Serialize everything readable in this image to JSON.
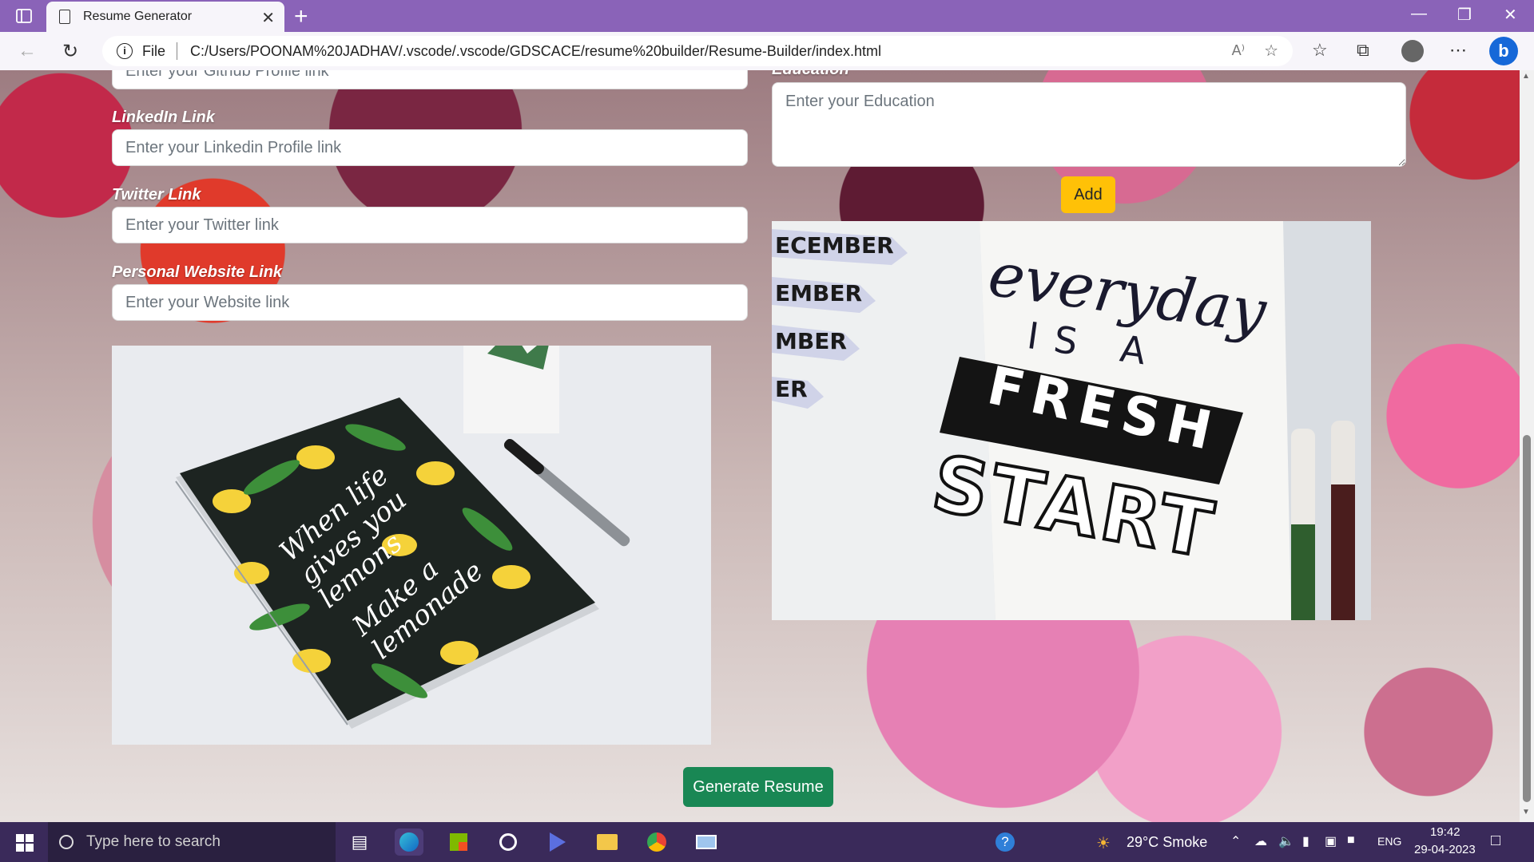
{
  "browser": {
    "tab_title": "Resume Generator",
    "tab_close_glyph": "✕",
    "new_tab_glyph": "+",
    "url_scheme_label": "File",
    "url": "C:/Users/POONAM%20JADHAV/.vscode/.vscode/GDSCACE/resume%20builder/Resume-Builder/index.html"
  },
  "form": {
    "github": {
      "placeholder": "Enter your Github Profile link"
    },
    "linkedin": {
      "label": "LinkedIn Link",
      "placeholder": "Enter your Linkedin Profile link"
    },
    "twitter": {
      "label": "Twitter Link",
      "placeholder": "Enter your Twitter link"
    },
    "website": {
      "label": "Personal Website Link",
      "placeholder": "Enter your Website link"
    },
    "education": {
      "label": "Education",
      "placeholder": "Enter your Education"
    },
    "add_label": "Add",
    "generate_label": "Generate Resume"
  },
  "images": {
    "notebook_text": [
      "When life",
      "gives you",
      "lemons",
      "Make a",
      "lemonade"
    ],
    "journal_text": {
      "line1": "everyday",
      "line2": "IS A",
      "line3": "FRESH",
      "line4": "START",
      "months": [
        "ECEMBER",
        "EMBER",
        "MBER",
        "ER"
      ]
    }
  },
  "taskbar": {
    "search_placeholder": "Type here to search",
    "weather": "29°C  Smoke",
    "language": "ENG",
    "time": "19:42",
    "date": "29-04-2023"
  },
  "colors": {
    "tabbar": "#8a63b8",
    "add_button": "#ffc107",
    "generate_button": "#198754",
    "taskbar": "#3a2a5a"
  },
  "icons": [
    "sidebar-toggle-icon",
    "document-icon",
    "back-icon",
    "refresh-icon",
    "info-icon",
    "read-aloud-icon",
    "add-favorite-icon",
    "favorites-icon",
    "collections-icon",
    "profile-icon",
    "more-icon",
    "bing-icon",
    "windows-start-icon",
    "search-icon",
    "task-view-icon",
    "edge-icon",
    "store-icon",
    "app-icon",
    "video-icon",
    "file-explorer-icon",
    "chrome-icon",
    "remote-desktop-icon",
    "help-icon",
    "weather-icon"
  ]
}
